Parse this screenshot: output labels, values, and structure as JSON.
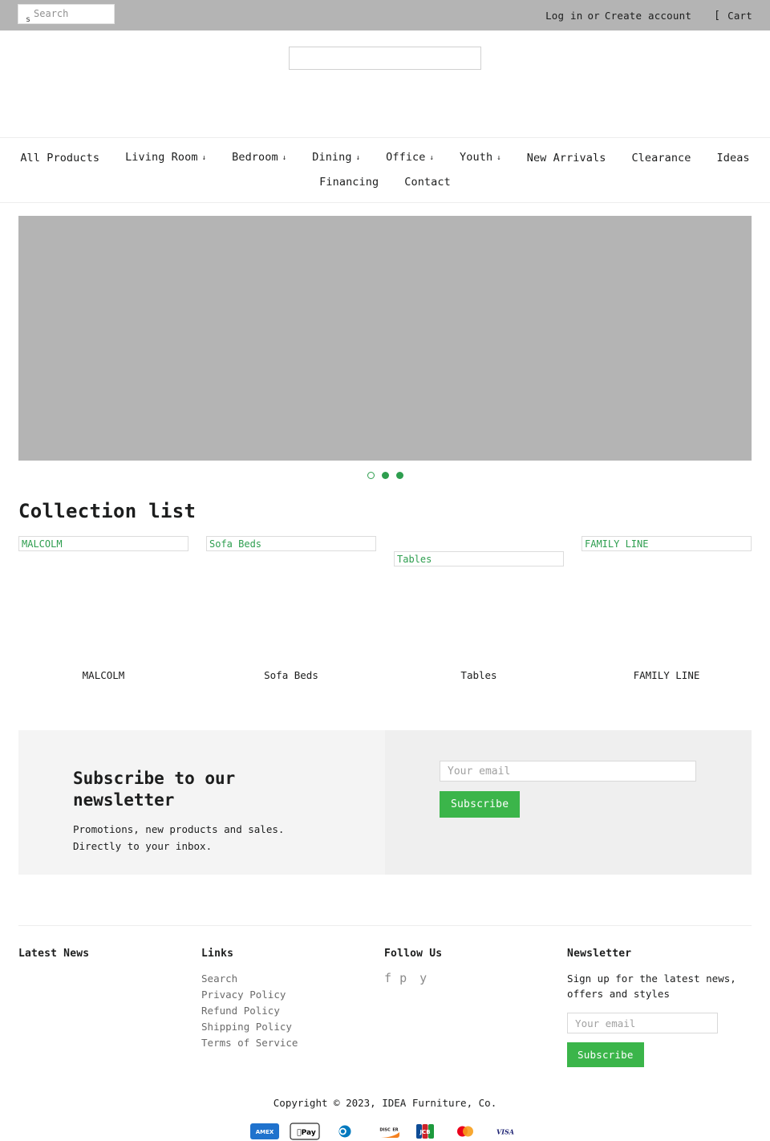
{
  "topbar": {
    "search": {
      "placeholder": "Search",
      "value": "",
      "icon": "search-icon",
      "icon_glyph": "s"
    },
    "login_label": "Log in",
    "or_label": "or",
    "create_account_label": "Create account",
    "cart_label": "Cart",
    "cart_icon_glyph": "[",
    "background": "#b4b4b4"
  },
  "header": {
    "logo_alt": ""
  },
  "nav": {
    "row1": [
      {
        "label": "All Products",
        "has_dropdown": false
      },
      {
        "label": "Living Room",
        "has_dropdown": true
      },
      {
        "label": "Bedroom",
        "has_dropdown": true
      },
      {
        "label": "Dining",
        "has_dropdown": true
      },
      {
        "label": "Office",
        "has_dropdown": true
      },
      {
        "label": "Youth",
        "has_dropdown": true
      },
      {
        "label": "New Arrivals",
        "has_dropdown": false
      },
      {
        "label": "Clearance",
        "has_dropdown": false
      },
      {
        "label": "Ideas",
        "has_dropdown": false
      }
    ],
    "row2": [
      {
        "label": "Financing",
        "has_dropdown": false
      },
      {
        "label": "Contact",
        "has_dropdown": false
      }
    ],
    "caret_glyph": "↓"
  },
  "hero": {
    "placeholder_color": "#b4b4b4",
    "slides": 3,
    "active_slide": 1
  },
  "collections": {
    "title": "Collection list",
    "accent_color": "#2e9e4f",
    "items": [
      {
        "alt": "MALCOLM",
        "title": "MALCOLM",
        "offset": 0
      },
      {
        "alt": "Sofa Beds",
        "title": "Sofa Beds",
        "offset": 0
      },
      {
        "alt": "Tables",
        "title": "Tables",
        "offset": 1
      },
      {
        "alt": "FAMILY LINE",
        "title": "FAMILY LINE",
        "offset": 0
      }
    ]
  },
  "newsletter_band": {
    "heading": "Subscribe to our newsletter",
    "subtext_line1": "Promotions, new products and sales.",
    "subtext_line2": "Directly to your inbox.",
    "email_placeholder": "Your email",
    "email_value": "",
    "button_label": "Subscribe",
    "button_color": "#3bb54a"
  },
  "footer": {
    "latest_news": {
      "heading": "Latest News"
    },
    "links": {
      "heading": "Links",
      "items": [
        {
          "label": "Search"
        },
        {
          "label": "Privacy Policy"
        },
        {
          "label": "Refund Policy"
        },
        {
          "label": "Shipping Policy"
        },
        {
          "label": "Terms of Service"
        }
      ]
    },
    "follow": {
      "heading": "Follow Us",
      "icons": [
        {
          "name": "facebook-icon",
          "glyph": "f"
        },
        {
          "name": "pinterest-icon",
          "glyph": "p"
        },
        {
          "name": "youtube-icon",
          "glyph": "y"
        }
      ]
    },
    "newsletter": {
      "heading": "Newsletter",
      "text": "Sign up for the latest news, offers and styles",
      "email_placeholder": "Your email",
      "email_value": "",
      "button_label": "Subscribe"
    },
    "copyright": "Copyright © 2023, IDEA Furniture, Co.",
    "payments": [
      {
        "name": "amex-icon",
        "label": "AMEX"
      },
      {
        "name": "apple-pay-icon",
        "label": "Pay"
      },
      {
        "name": "diners-club-icon",
        "label": ""
      },
      {
        "name": "discover-icon",
        "label": "DISCOVER"
      },
      {
        "name": "jcb-icon",
        "label": "JCB"
      },
      {
        "name": "mastercard-icon",
        "label": ""
      },
      {
        "name": "visa-icon",
        "label": "VISA"
      }
    ]
  }
}
